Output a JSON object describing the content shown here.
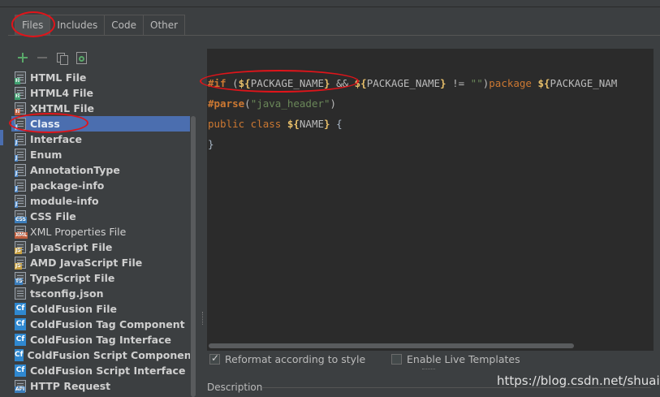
{
  "tabs": [
    {
      "label": "Files",
      "active": true
    },
    {
      "label": "Includes",
      "active": false
    },
    {
      "label": "Code",
      "active": false
    },
    {
      "label": "Other",
      "active": false
    }
  ],
  "toolbar": {
    "icons": [
      "add-icon",
      "remove-icon",
      "copy-icon",
      "reset-icon"
    ]
  },
  "templates": [
    {
      "label": "HTML File",
      "icon": "html-file-icon",
      "badge": "H"
    },
    {
      "label": "HTML4 File",
      "icon": "html-file-icon",
      "badge": "H"
    },
    {
      "label": "XHTML File",
      "icon": "xhtml-file-icon",
      "badge": "H"
    },
    {
      "label": "Class",
      "icon": "java-file-icon",
      "badge": "J",
      "selected": true
    },
    {
      "label": "Interface",
      "icon": "java-file-icon",
      "badge": "J"
    },
    {
      "label": "Enum",
      "icon": "java-file-icon",
      "badge": "J"
    },
    {
      "label": "AnnotationType",
      "icon": "java-file-icon",
      "badge": "J"
    },
    {
      "label": "package-info",
      "icon": "java-file-icon",
      "badge": "J"
    },
    {
      "label": "module-info",
      "icon": "java-file-icon",
      "badge": "J"
    },
    {
      "label": "CSS File",
      "icon": "css-file-icon",
      "badge": "CSS"
    },
    {
      "label": "XML Properties File",
      "icon": "xml-file-icon",
      "badge": "XML",
      "plain": true
    },
    {
      "label": "JavaScript File",
      "icon": "js-file-icon",
      "badge": "JS"
    },
    {
      "label": "AMD JavaScript File",
      "icon": "js-file-icon",
      "badge": "JS"
    },
    {
      "label": "TypeScript File",
      "icon": "ts-file-icon",
      "badge": "TS"
    },
    {
      "label": "tsconfig.json",
      "icon": "json-file-icon",
      "badge": ""
    },
    {
      "label": "ColdFusion File",
      "icon": "coldfusion-icon",
      "badge": "Cf"
    },
    {
      "label": "ColdFusion Tag Component",
      "icon": "coldfusion-icon",
      "badge": "Cf"
    },
    {
      "label": "ColdFusion Tag Interface",
      "icon": "coldfusion-icon",
      "badge": "Cf"
    },
    {
      "label": "ColdFusion Script Component",
      "icon": "coldfusion-icon",
      "badge": "Cf"
    },
    {
      "label": "ColdFusion Script Interface",
      "icon": "coldfusion-icon",
      "badge": "Cf"
    },
    {
      "label": "HTTP Request",
      "icon": "http-request-icon",
      "badge": "API"
    }
  ],
  "editor": {
    "line1": {
      "if": "#if",
      "open": " (",
      "d1": "${",
      "v1": "PACKAGE_NAME",
      "c1": "}",
      "and": " && ",
      "d2": "${",
      "v2": "PACKAGE_NAME",
      "c2": "}",
      "ne": " != ",
      "str": "\"\"",
      "close": ")",
      "pkg": "package ",
      "d3": "${",
      "v3": "PACKAGE_NAM"
    },
    "line2": {
      "parse": "#parse",
      "open": "(",
      "str": "\"java_header\"",
      "close": ")"
    },
    "line3": {
      "kw": "public class ",
      "d": "${",
      "v": "NAME",
      "c": "}",
      "brace": " {"
    },
    "line4": "}"
  },
  "options": {
    "reformat": {
      "label": "Reformat according to style",
      "checked": true
    },
    "live_templates": {
      "label": "Enable Live Templates",
      "checked": false
    }
  },
  "description_label": "Description",
  "watermark": "https://blog.csdn.net/shuair",
  "colors": {
    "background": "#3c3f41",
    "editor_bg": "#2b2b2b",
    "selection": "#4b6eaf",
    "annotation_red": "#e0141a"
  }
}
